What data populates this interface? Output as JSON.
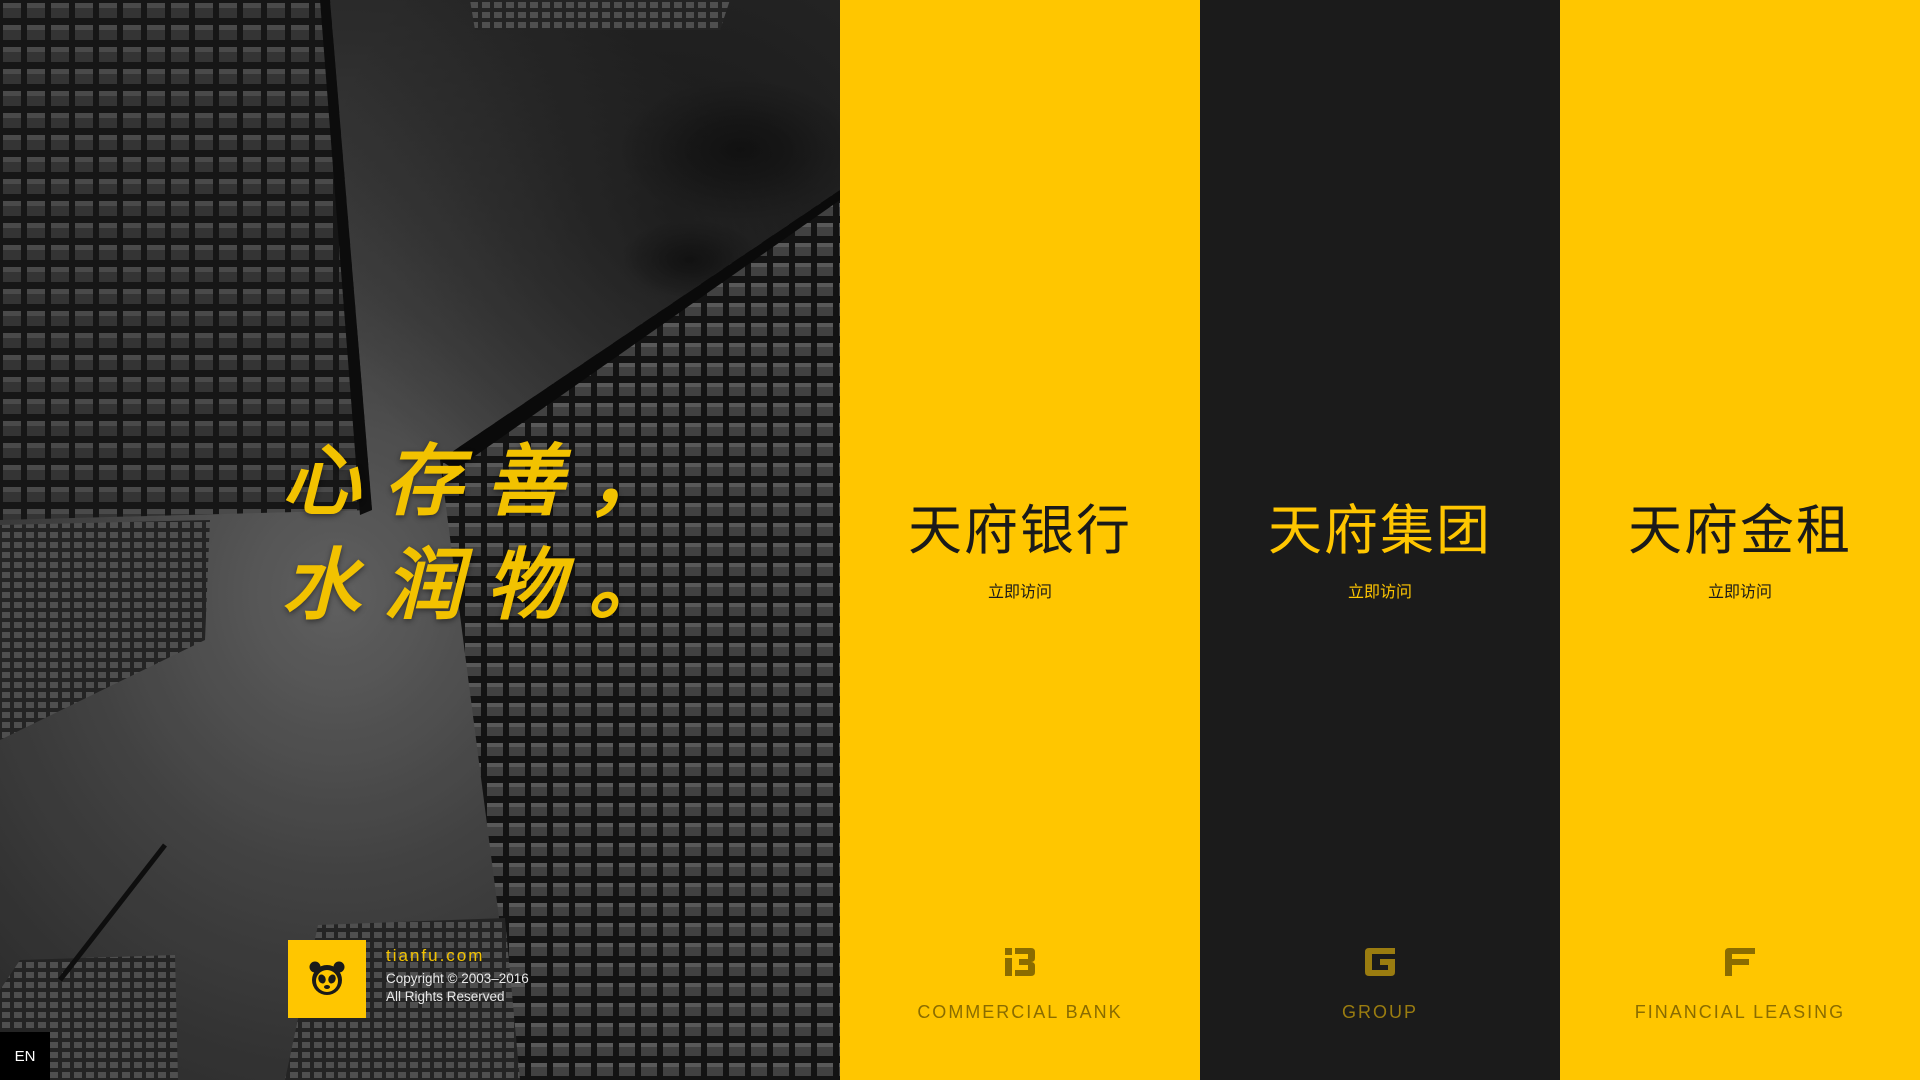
{
  "hero": {
    "slogan_line1": "心存善，",
    "slogan_line2": "水润物。",
    "brand": {
      "logo_icon": "panda-icon",
      "domain": "tianfu.com",
      "copyright": "Copyright © 2003–2016",
      "rights": "All Rights Reserved"
    },
    "language_button": "EN"
  },
  "columns": [
    {
      "title": "天府银行",
      "visit_label": "立即访问",
      "icon": "bank-monogram-icon",
      "subtitle": "COMMERCIAL BANK",
      "theme": "yellow"
    },
    {
      "title": "天府集团",
      "visit_label": "立即访问",
      "icon": "group-monogram-icon",
      "subtitle": "GROUP",
      "theme": "dark"
    },
    {
      "title": "天府金租",
      "visit_label": "立即访问",
      "icon": "leasing-monogram-icon",
      "subtitle": "FINANCIAL LEASING",
      "theme": "yellow"
    }
  ],
  "colors": {
    "brand_yellow": "#ffc600",
    "dark": "#1b1b1b",
    "muted_gold": "#8a6c00"
  }
}
